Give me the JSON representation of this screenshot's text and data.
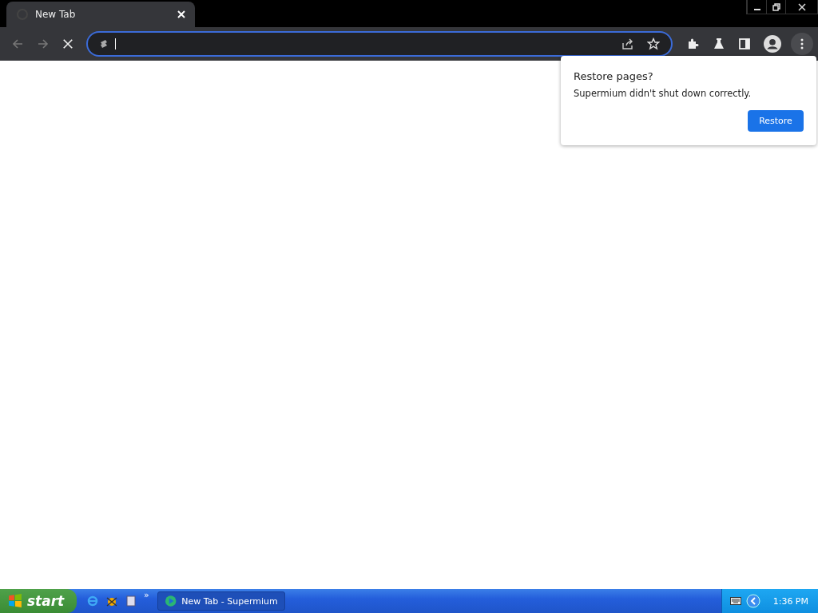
{
  "tab": {
    "title": "New Tab",
    "selected": true
  },
  "popup": {
    "title": "Restore pages?",
    "message": "Supermium didn't shut down correctly.",
    "button": "Restore"
  },
  "taskbar": {
    "start": "start",
    "overflow": "»",
    "task": "New Tab - Supermium",
    "clock": "1:36 PM"
  }
}
